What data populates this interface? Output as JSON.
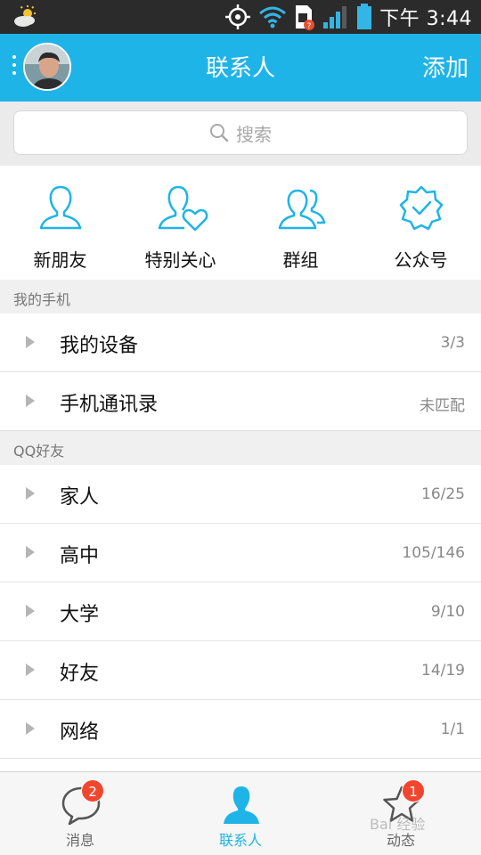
{
  "status_bar": {
    "time": "下午 3:44",
    "icons": [
      "weather-icon",
      "gps-icon",
      "wifi-icon",
      "sim-alert-icon",
      "signal-icon",
      "battery-icon"
    ]
  },
  "header": {
    "title": "联系人",
    "add_label": "添加",
    "accent_color": "#1eb4e8"
  },
  "search": {
    "placeholder": "搜索"
  },
  "quick_entries": [
    {
      "label": "新朋友",
      "icon": "new-friend-icon"
    },
    {
      "label": "特别关心",
      "icon": "special-care-icon"
    },
    {
      "label": "群组",
      "icon": "group-icon"
    },
    {
      "label": "公众号",
      "icon": "official-account-icon"
    }
  ],
  "sections": [
    {
      "title": "我的手机",
      "rows": [
        {
          "name": "我的设备",
          "count": "3/3"
        },
        {
          "name": "手机通讯录",
          "count": "未匹配"
        }
      ]
    },
    {
      "title": "QQ好友",
      "rows": [
        {
          "name": "家人",
          "count": "16/25"
        },
        {
          "name": "高中",
          "count": "105/146"
        },
        {
          "name": "大学",
          "count": "9/10"
        },
        {
          "name": "好友",
          "count": "14/19"
        },
        {
          "name": "网络",
          "count": "1/1"
        }
      ]
    }
  ],
  "tabs": [
    {
      "label": "消息",
      "badge": "2",
      "icon": "message-icon"
    },
    {
      "label": "联系人",
      "badge": "",
      "icon": "contacts-icon"
    },
    {
      "label": "动态",
      "badge": "1",
      "icon": "star-icon"
    }
  ],
  "watermark": "Bai 经验"
}
